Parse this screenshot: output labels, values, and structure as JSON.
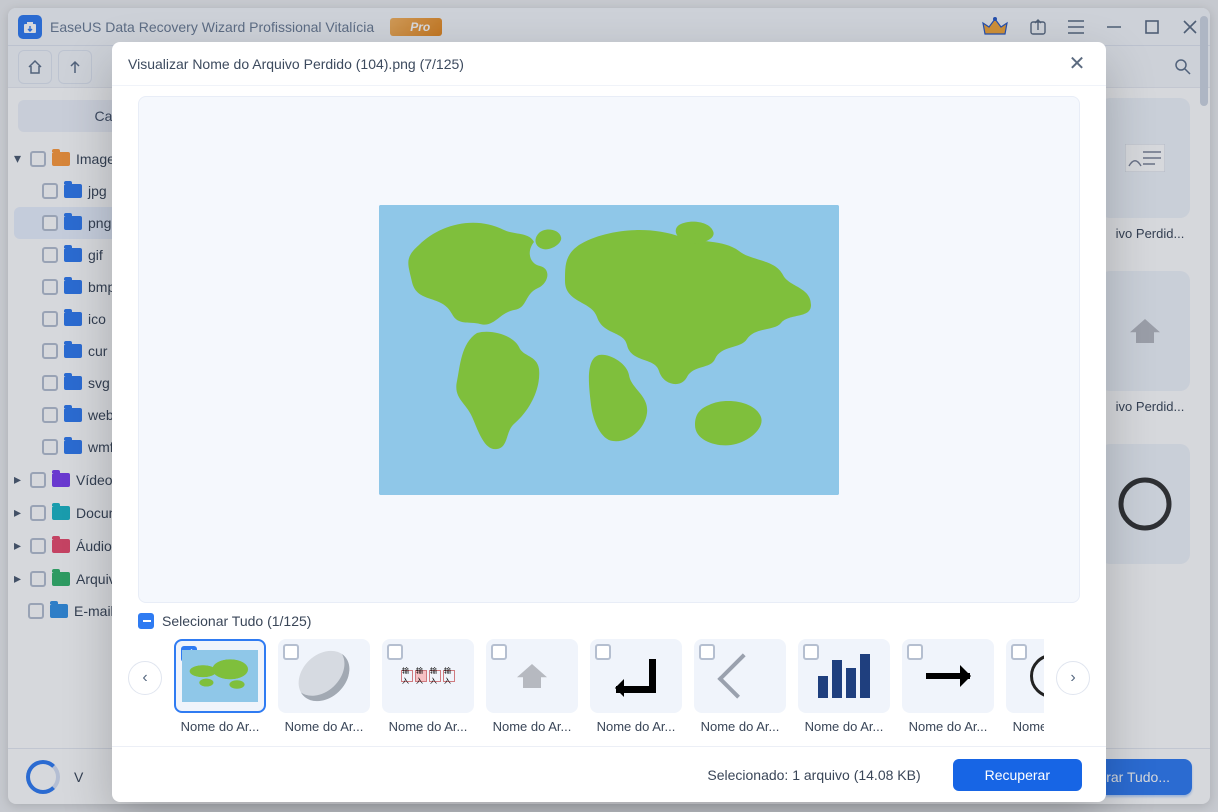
{
  "app": {
    "title": "EaseUS Data Recovery Wizard Profissional Vitalícia",
    "pro": "Pro"
  },
  "sidebar": {
    "path_tab": "Caminho",
    "items": [
      {
        "label": "Imagens",
        "type": "pic"
      },
      {
        "label": "jpg"
      },
      {
        "label": "png"
      },
      {
        "label": "gif"
      },
      {
        "label": "bmp"
      },
      {
        "label": "ico"
      },
      {
        "label": "cur"
      },
      {
        "label": "svg"
      },
      {
        "label": "webp"
      },
      {
        "label": "wmf"
      }
    ],
    "bottom": [
      {
        "label": "Vídeos",
        "type": "vid"
      },
      {
        "label": "Documentos",
        "type": "doc"
      },
      {
        "label": "Áudios",
        "type": "aud"
      },
      {
        "label": "Arquivos",
        "type": "arc"
      },
      {
        "label": "E-mails",
        "type": "eml"
      }
    ]
  },
  "gridright": [
    {
      "label": "ivo Perdid..."
    },
    {
      "label": "ivo Perdid..."
    }
  ],
  "bottombar": {
    "recover_all": "Recuperar Tudo..."
  },
  "modal": {
    "title": "Visualizar Nome do Arquivo Perdido (104).png (7/125)",
    "select_all": "Selecionar Tudo (1/125)",
    "thumbs": [
      {
        "label": "Nome do Ar...",
        "sel": true,
        "g": "map"
      },
      {
        "label": "Nome do Ar...",
        "g": "dish"
      },
      {
        "label": "Nome do Ar...",
        "g": "boxes"
      },
      {
        "label": "Nome do Ar...",
        "g": "home"
      },
      {
        "label": "Nome do Ar...",
        "g": "enter"
      },
      {
        "label": "Nome do Ar...",
        "g": "back"
      },
      {
        "label": "Nome do Ar...",
        "g": "bars"
      },
      {
        "label": "Nome do Ar...",
        "g": "arrow"
      },
      {
        "label": "Nome do Ar...",
        "g": "info"
      }
    ],
    "status": "Selecionado: 1 arquivo (14.08 KB)",
    "recover": "Recuperar"
  }
}
